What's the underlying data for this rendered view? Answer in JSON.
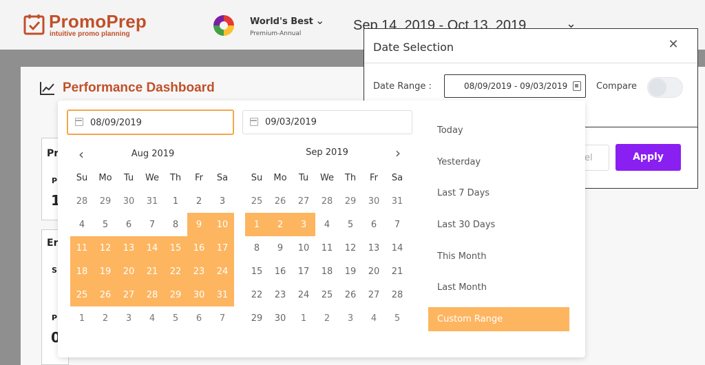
{
  "app": {
    "brand_title": "PromoPrep",
    "brand_tagline": "intuitive promo planning",
    "org_name": "World's Best",
    "org_plan": "Premium-Annual",
    "header_range": "Sep 14, 2019 - Oct 13, 2019",
    "dashboard_title": "Performance Dashboard",
    "bg_glyphs": [
      "Pr",
      "P",
      "1",
      "Er",
      "S",
      "P",
      "0"
    ]
  },
  "modal": {
    "title": "Date Selection",
    "date_range_label": "Date Range :",
    "date_range_value": "08/09/2019 - 09/03/2019",
    "compare_label": "Compare",
    "compare_on": false,
    "cancel_label": "el",
    "apply_label": "Apply"
  },
  "picker": {
    "start_value": "08/09/2019",
    "end_value": "09/03/2019",
    "weekdays": [
      "Su",
      "Mo",
      "Tu",
      "We",
      "Th",
      "Fr",
      "Sa"
    ],
    "calendars": [
      {
        "title": "Aug 2019",
        "weeks": [
          [
            {
              "d": "28",
              "o": 1
            },
            {
              "d": "29",
              "o": 1
            },
            {
              "d": "30",
              "o": 1
            },
            {
              "d": "31",
              "o": 1
            },
            {
              "d": "1"
            },
            {
              "d": "2"
            },
            {
              "d": "3"
            }
          ],
          [
            {
              "d": "4"
            },
            {
              "d": "5"
            },
            {
              "d": "6"
            },
            {
              "d": "7"
            },
            {
              "d": "8"
            },
            {
              "d": "9",
              "s": 1
            },
            {
              "d": "10",
              "s": 1
            }
          ],
          [
            {
              "d": "11",
              "s": 1
            },
            {
              "d": "12",
              "s": 1
            },
            {
              "d": "13",
              "s": 1
            },
            {
              "d": "14",
              "s": 1
            },
            {
              "d": "15",
              "s": 1
            },
            {
              "d": "16",
              "s": 1
            },
            {
              "d": "17",
              "s": 1
            }
          ],
          [
            {
              "d": "18",
              "s": 1
            },
            {
              "d": "19",
              "s": 1
            },
            {
              "d": "20",
              "s": 1
            },
            {
              "d": "21",
              "s": 1
            },
            {
              "d": "22",
              "s": 1
            },
            {
              "d": "23",
              "s": 1
            },
            {
              "d": "24",
              "s": 1
            }
          ],
          [
            {
              "d": "25",
              "s": 1
            },
            {
              "d": "26",
              "s": 1
            },
            {
              "d": "27",
              "s": 1
            },
            {
              "d": "28",
              "s": 1
            },
            {
              "d": "29",
              "s": 1
            },
            {
              "d": "30",
              "s": 1
            },
            {
              "d": "31",
              "s": 1
            }
          ],
          [
            {
              "d": "1",
              "o": 1
            },
            {
              "d": "2",
              "o": 1
            },
            {
              "d": "3",
              "o": 1
            },
            {
              "d": "4",
              "o": 1
            },
            {
              "d": "5",
              "o": 1
            },
            {
              "d": "6",
              "o": 1
            },
            {
              "d": "7",
              "o": 1
            }
          ]
        ]
      },
      {
        "title": "Sep 2019",
        "weeks": [
          [
            {
              "d": "25",
              "o": 1
            },
            {
              "d": "26",
              "o": 1
            },
            {
              "d": "27",
              "o": 1
            },
            {
              "d": "28",
              "o": 1
            },
            {
              "d": "29",
              "o": 1
            },
            {
              "d": "30",
              "o": 1
            },
            {
              "d": "31",
              "o": 1
            }
          ],
          [
            {
              "d": "1",
              "s": 1
            },
            {
              "d": "2",
              "s": 1
            },
            {
              "d": "3",
              "s": 1
            },
            {
              "d": "4"
            },
            {
              "d": "5"
            },
            {
              "d": "6"
            },
            {
              "d": "7"
            }
          ],
          [
            {
              "d": "8"
            },
            {
              "d": "9"
            },
            {
              "d": "10"
            },
            {
              "d": "11"
            },
            {
              "d": "12"
            },
            {
              "d": "13"
            },
            {
              "d": "14"
            }
          ],
          [
            {
              "d": "15"
            },
            {
              "d": "16"
            },
            {
              "d": "17"
            },
            {
              "d": "18"
            },
            {
              "d": "19"
            },
            {
              "d": "20"
            },
            {
              "d": "21"
            }
          ],
          [
            {
              "d": "22"
            },
            {
              "d": "23"
            },
            {
              "d": "24"
            },
            {
              "d": "25"
            },
            {
              "d": "26"
            },
            {
              "d": "27"
            },
            {
              "d": "28"
            }
          ],
          [
            {
              "d": "29"
            },
            {
              "d": "30"
            },
            {
              "d": "1",
              "o": 1
            },
            {
              "d": "2",
              "o": 1
            },
            {
              "d": "3",
              "o": 1
            },
            {
              "d": "4",
              "o": 1
            },
            {
              "d": "5",
              "o": 1
            }
          ]
        ]
      }
    ],
    "ranges": [
      "Today",
      "Yesterday",
      "Last 7 Days",
      "Last 30 Days",
      "This Month",
      "Last Month",
      "Custom Range"
    ],
    "active_range": "Custom Range"
  },
  "colors": {
    "accent_orange": "#fdb560",
    "apply_purple": "#8a1ff2",
    "brand_rust": "#c0502a"
  }
}
